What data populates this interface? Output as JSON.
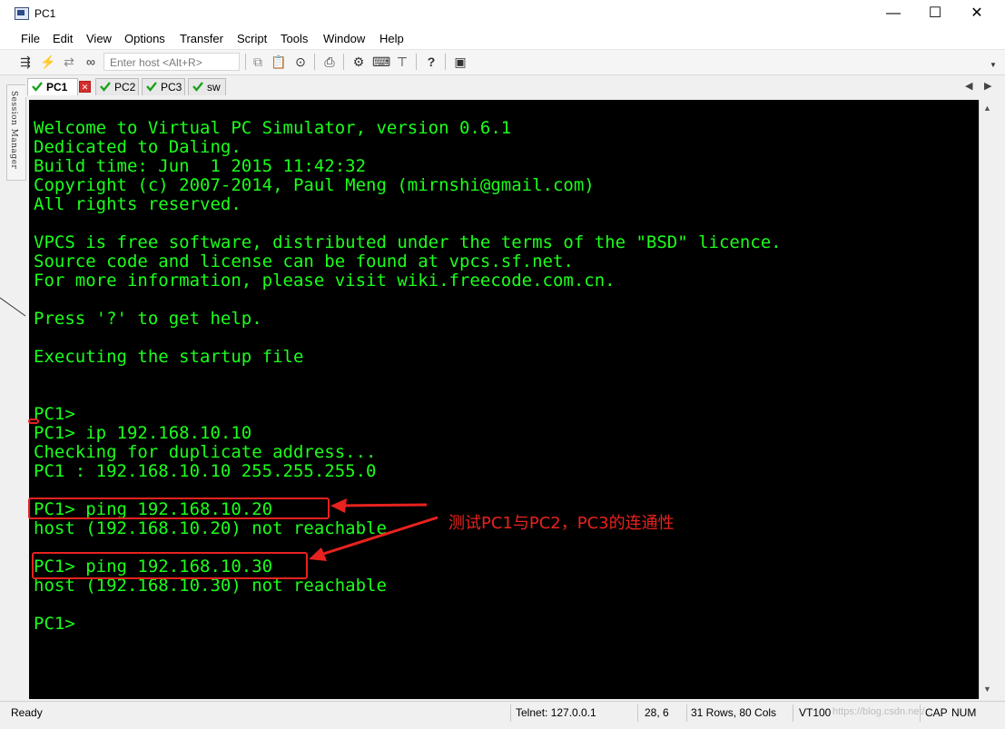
{
  "window": {
    "title": "PC1",
    "minimize": "—",
    "maximize": "☐",
    "close": "✕"
  },
  "menu": [
    "File",
    "Edit",
    "View",
    "Options",
    "Transfer",
    "Script",
    "Tools",
    "Window",
    "Help"
  ],
  "toolbar": {
    "host_placeholder": "Enter host <Alt+R>",
    "icons": [
      "connect-icon",
      "lightning-icon",
      "reconnect-icon",
      "disconnect-icon",
      "copy-icon",
      "paste-icon",
      "find-icon",
      "print-icon",
      "settings-icon",
      "keymap-icon",
      "sftp-icon",
      "help-icon",
      "script-icon"
    ]
  },
  "sidebar": {
    "label": "Session Manager"
  },
  "tabs": [
    {
      "label": "PC1",
      "active": true
    },
    {
      "label": "PC2",
      "active": false
    },
    {
      "label": "PC3",
      "active": false
    },
    {
      "label": "sw",
      "active": false
    }
  ],
  "terminal": {
    "lines": [
      "Welcome to Virtual PC Simulator, version 0.6.1",
      "Dedicated to Daling.",
      "Build time: Jun  1 2015 11:42:32",
      "Copyright (c) 2007-2014, Paul Meng (mirnshi@gmail.com)",
      "All rights reserved.",
      "",
      "VPCS is free software, distributed under the terms of the \"BSD\" licence.",
      "Source code and license can be found at vpcs.sf.net.",
      "For more information, please visit wiki.freecode.com.cn.",
      "",
      "Press '?' to get help.",
      "",
      "Executing the startup file",
      "",
      "",
      "PC1>",
      "PC1> ip 192.168.10.10",
      "Checking for duplicate address...",
      "PC1 : 192.168.10.10 255.255.255.0",
      "",
      "PC1> ping 192.168.10.20",
      "host (192.168.10.20) not reachable",
      "",
      "PC1> ping 192.168.10.30",
      "host (192.168.10.30) not reachable",
      "",
      "PC1>"
    ],
    "text_color": "#1cff1c"
  },
  "annotation": {
    "text": "测试PC1与PC2，PC3的连通性",
    "color": "#e8221e"
  },
  "status": {
    "ready": "Ready",
    "connection": "Telnet: 127.0.0.1",
    "cursor": "28,   6",
    "size": "31 Rows, 80 Cols",
    "emulation": "VT100",
    "watermark": "https://blog.csdn.net/...",
    "caps": "CAP",
    "num": "NUM"
  }
}
